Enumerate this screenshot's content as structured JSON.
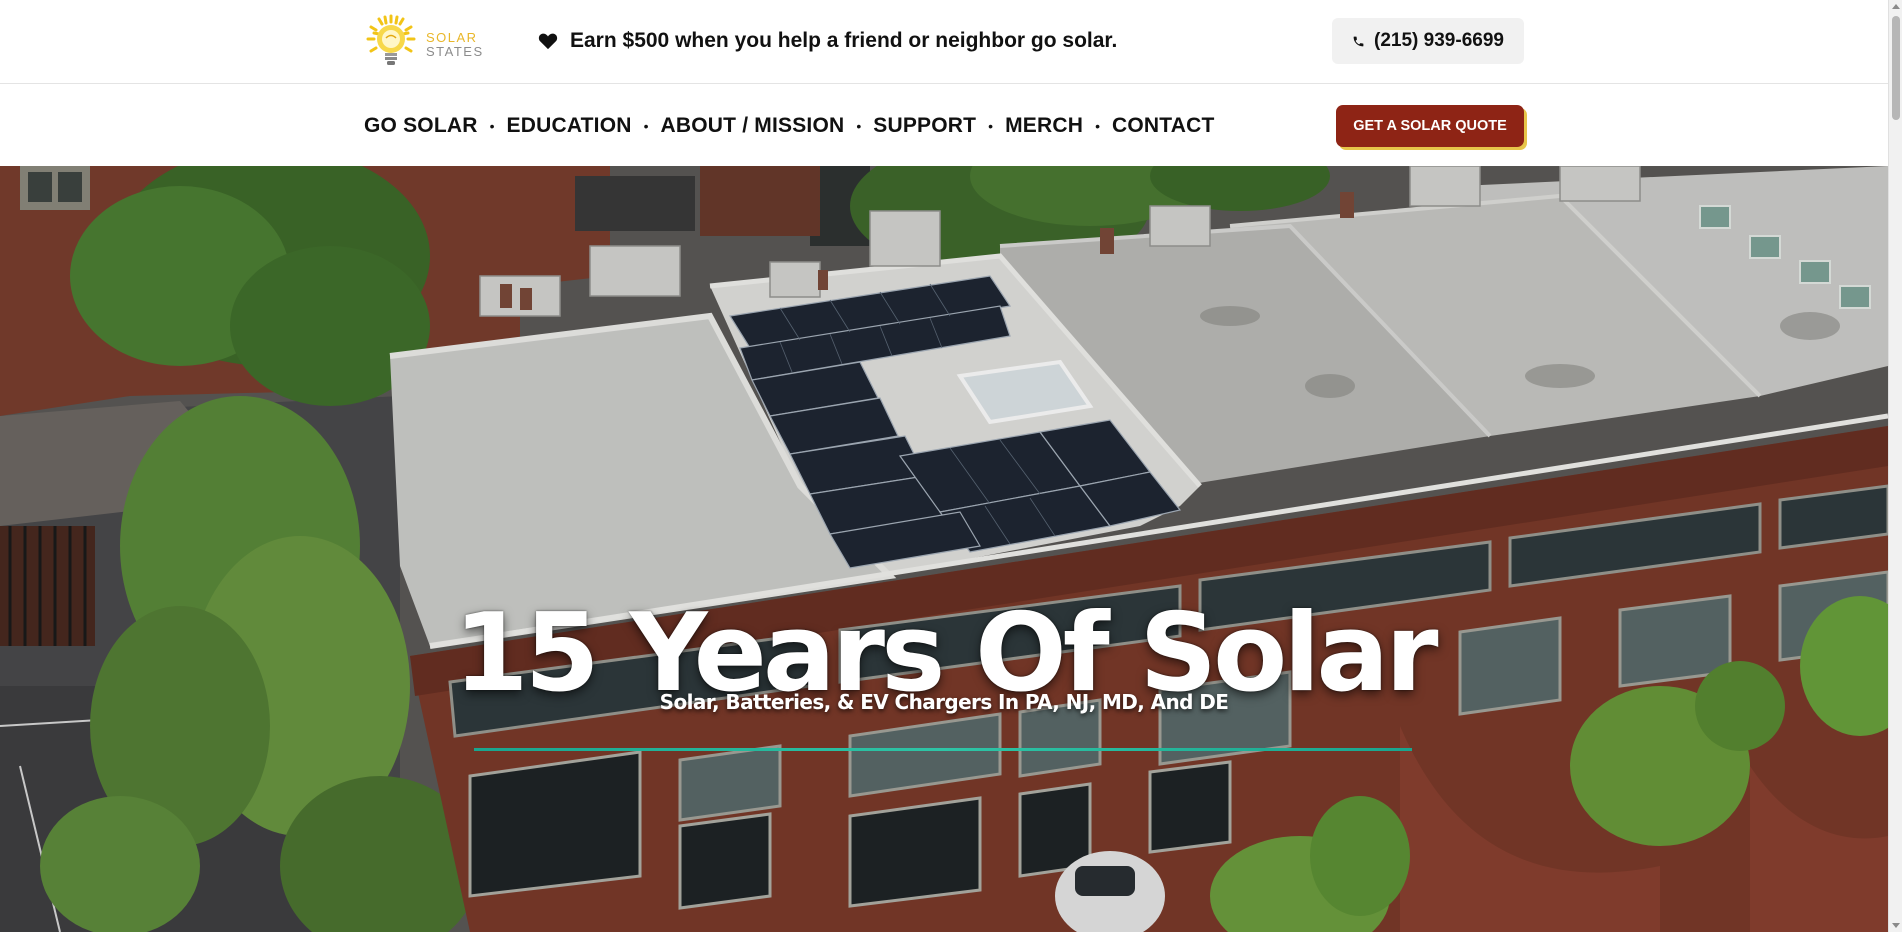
{
  "brand": {
    "logo_line1": "SOLAR",
    "logo_line2": "STATES",
    "logo_icon": "sun-bulb-logo-icon",
    "sun_color": "#f2c417",
    "text_gold": "#e9b72a",
    "text_gray": "#8c8c8c"
  },
  "topbar": {
    "promo_icon": "heart-icon",
    "promo_text": "Earn $500 when you help a friend or neighbor go solar.",
    "phone_icon": "phone-icon",
    "phone_number": "(215) 939-6699"
  },
  "nav": {
    "items": [
      {
        "label": "GO SOLAR"
      },
      {
        "label": "EDUCATION"
      },
      {
        "label": "ABOUT / MISSION"
      },
      {
        "label": "SUPPORT"
      },
      {
        "label": "MERCH"
      },
      {
        "label": "CONTACT"
      }
    ],
    "separator": "•",
    "cta_label": "GET A SOLAR QUOTE",
    "cta_color": "#8e2415",
    "cta_shadow_color": "#e7c54a"
  },
  "hero": {
    "title": "15 Years Of Solar",
    "subtitle": "Solar, Batteries, & EV Chargers In PA, NJ, MD, And DE",
    "rule_color": "#1aa58e"
  }
}
